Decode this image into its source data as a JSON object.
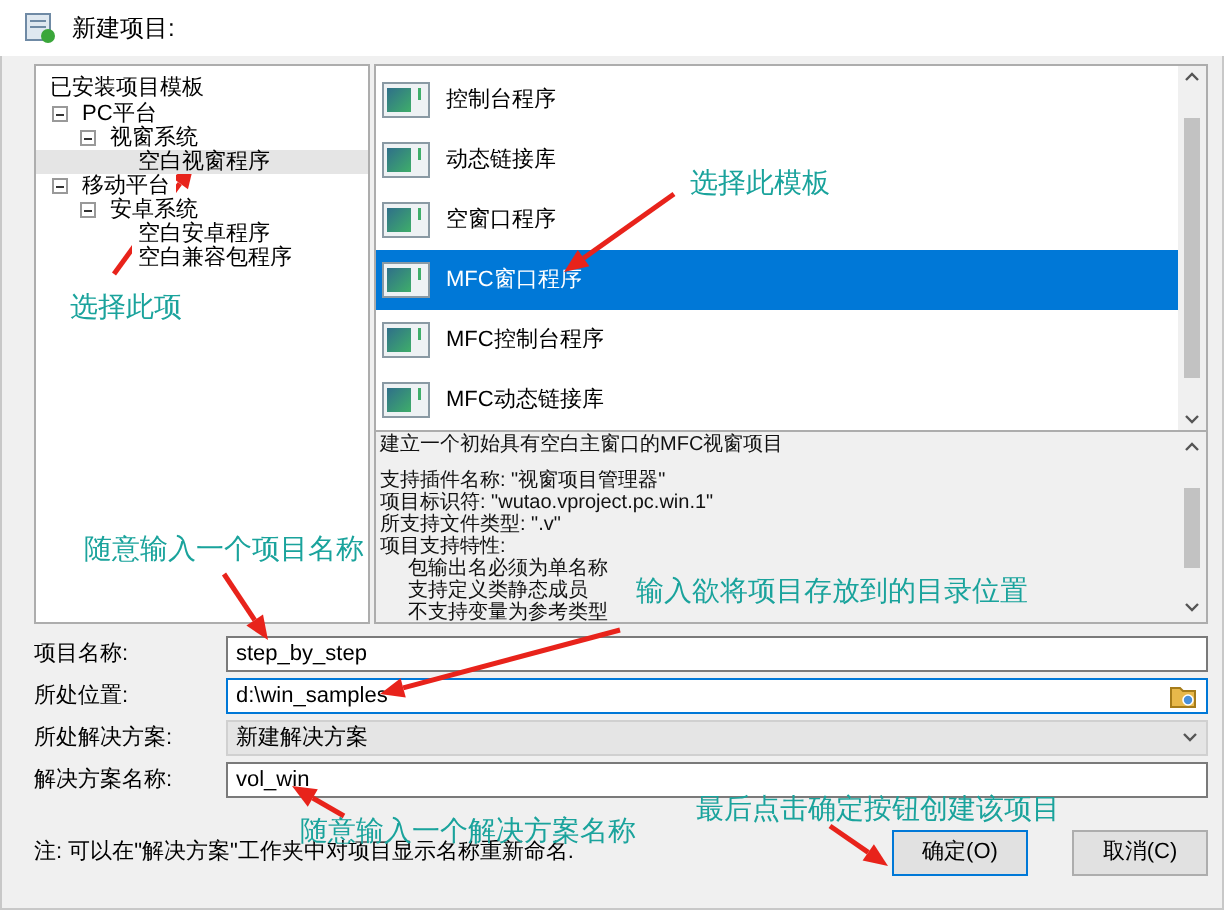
{
  "window": {
    "title": "新建项目:"
  },
  "tree": {
    "label": "已安装项目模板",
    "children": [
      {
        "label": "PC平台",
        "expanded": true,
        "selected": false,
        "children": [
          {
            "label": "视窗系统",
            "expanded": true,
            "selected": false,
            "children": [
              {
                "label": "空白视窗程序",
                "selected": true
              }
            ]
          }
        ]
      },
      {
        "label": "移动平台",
        "expanded": true,
        "selected": false,
        "children": [
          {
            "label": "安卓系统",
            "expanded": true,
            "selected": false,
            "children": [
              {
                "label": "空白安卓程序",
                "selected": false
              },
              {
                "label": "空白兼容包程序",
                "selected": false
              }
            ]
          }
        ]
      }
    ]
  },
  "templates": [
    {
      "label": "控制台程序",
      "selected": false
    },
    {
      "label": "动态链接库",
      "selected": false
    },
    {
      "label": "空窗口程序",
      "selected": false
    },
    {
      "label": "MFC窗口程序",
      "selected": true
    },
    {
      "label": "MFC控制台程序",
      "selected": false
    },
    {
      "label": "MFC动态链接库",
      "selected": false
    }
  ],
  "description": {
    "summary": "建立一个初始具有空白主窗口的MFC视窗项目",
    "details": [
      "支持插件名称: \"视窗项目管理器\"",
      "项目标识符: \"wutao.vproject.pc.win.1\"",
      "所支持文件类型: \".v\"",
      "项目支持特性:"
    ],
    "features": [
      "包输出名必须为单名称",
      "支持定义类静态成员",
      "不支持变量为参考类型"
    ]
  },
  "form": [
    {
      "kind": "text",
      "label": "项目名称:",
      "value": "step_by_step",
      "focused": false
    },
    {
      "kind": "folder",
      "label": "所处位置:",
      "value": "d:\\win_samples",
      "focused": true
    },
    {
      "kind": "combo",
      "label": "所处解决方案:",
      "value": "新建解决方案",
      "focused": false
    },
    {
      "kind": "text",
      "label": "解决方案名称:",
      "value": "vol_win",
      "focused": false
    }
  ],
  "note": "注: 可以在\"解决方案\"工作夹中对项目显示名称重新命名.",
  "buttons": [
    {
      "label": "确定(O)",
      "default": true
    },
    {
      "label": "取消(C)",
      "default": false
    }
  ],
  "annotations": [
    "选择此项",
    "选择此模板",
    "随意输入一个项目名称",
    "输入欲将项目存放到的目录位置",
    "随意输入一个解决方案名称",
    "最后点击确定按钮创建该项目"
  ]
}
